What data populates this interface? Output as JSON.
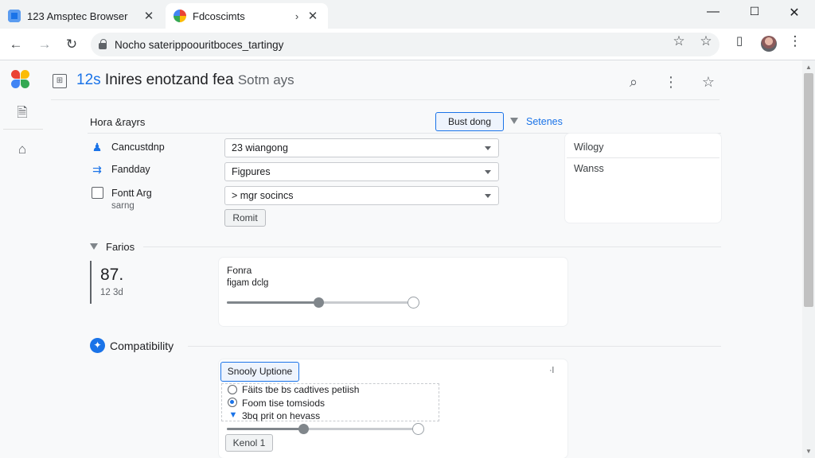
{
  "browser": {
    "name": "123 Amsptec Browser",
    "tabs": [
      {
        "label": "123 Amsptec Browser"
      },
      {
        "label": "Fdcoscimts"
      }
    ],
    "address": "Nocho saterippoouritboces_tartingy"
  },
  "app": {
    "title_num": "12s",
    "title_main": "Inires enotzand fea",
    "title_tail": "Sotm ays"
  },
  "section1": {
    "title": "Hora &rayrs",
    "rows": [
      {
        "label": "Cancustdnp",
        "select": "23 wiangong",
        "icon": "figure-icon"
      },
      {
        "label": "Fandday",
        "select": "Figpures",
        "icon": "dash-icon"
      },
      {
        "label": "Fontt Arg",
        "sublabel": "sarng",
        "select": "> mgr socincs",
        "icon": "checkbox"
      }
    ],
    "submit": "Romit",
    "top_button": "Bust dong",
    "settings_link": "Setenes",
    "side_items": [
      "Wilogy",
      "Wanss"
    ]
  },
  "section2": {
    "title": "Farios",
    "stat_value": "87.",
    "stat_sub": "12 3d",
    "card_title": "Fonra",
    "card_sub": "figam dclg",
    "slider_level": 0.49
  },
  "section3": {
    "title": "Compatibility",
    "button": "Snooly Uptione",
    "aside": "·l",
    "options": [
      {
        "label": "Fäits tbe bs cadtives petiish",
        "state": "empty"
      },
      {
        "label": "Foom tise tomsiods",
        "state": "selected"
      },
      {
        "label": "3bq prit on hevass",
        "state": "arrow"
      }
    ],
    "slider_level": 0.4,
    "footer_button": "Kenol 1"
  }
}
